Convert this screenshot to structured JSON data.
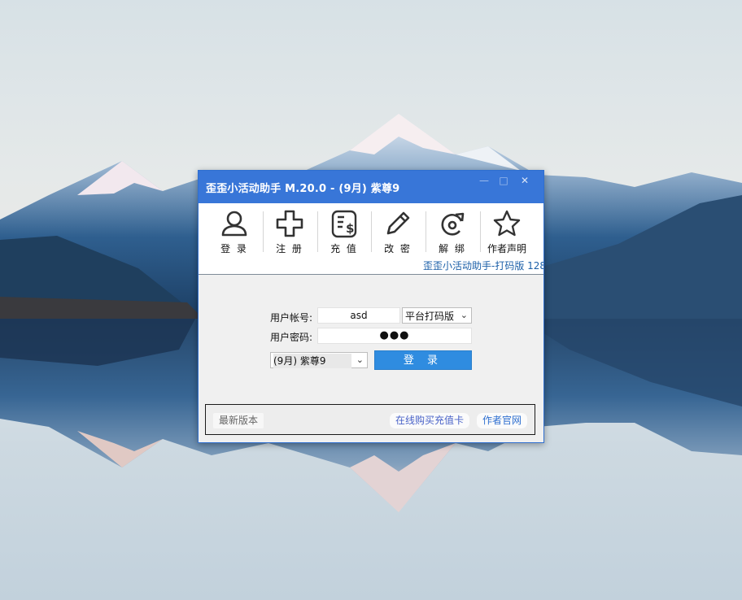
{
  "window": {
    "title": "歪歪小活动助手 M.20.0 - (9月) 紫尊9",
    "controls": {
      "minimize": "—",
      "maximize": "□",
      "close": "✕"
    }
  },
  "toolbar": {
    "items": [
      {
        "label": "登 录",
        "icon": "user-icon"
      },
      {
        "label": "注 册",
        "icon": "plus-icon"
      },
      {
        "label": "充 值",
        "icon": "bill-dollar-icon"
      },
      {
        "label": "改 密",
        "icon": "pencil-icon"
      },
      {
        "label": "解 绑",
        "icon": "refresh-arrow-icon"
      },
      {
        "label": "作者声明",
        "icon": "star-icon"
      }
    ]
  },
  "marquee": {
    "text": "歪歪小活动助手-打码版 128"
  },
  "login": {
    "account_label": "用户帐号:",
    "account_value": "asd",
    "mode_select": "平台打码版",
    "password_label": "用户密码:",
    "password_value": "●●●",
    "version_select": "(9月) 紫尊9",
    "login_button": "登 录"
  },
  "footer": {
    "latest_version": "最新版本",
    "buy_card": "在线购买充值卡",
    "author_site": "作者官网"
  },
  "colors": {
    "titlebar": "#3876d8",
    "login_button": "#2f8ce0",
    "marquee_text": "#1b5fa8"
  }
}
